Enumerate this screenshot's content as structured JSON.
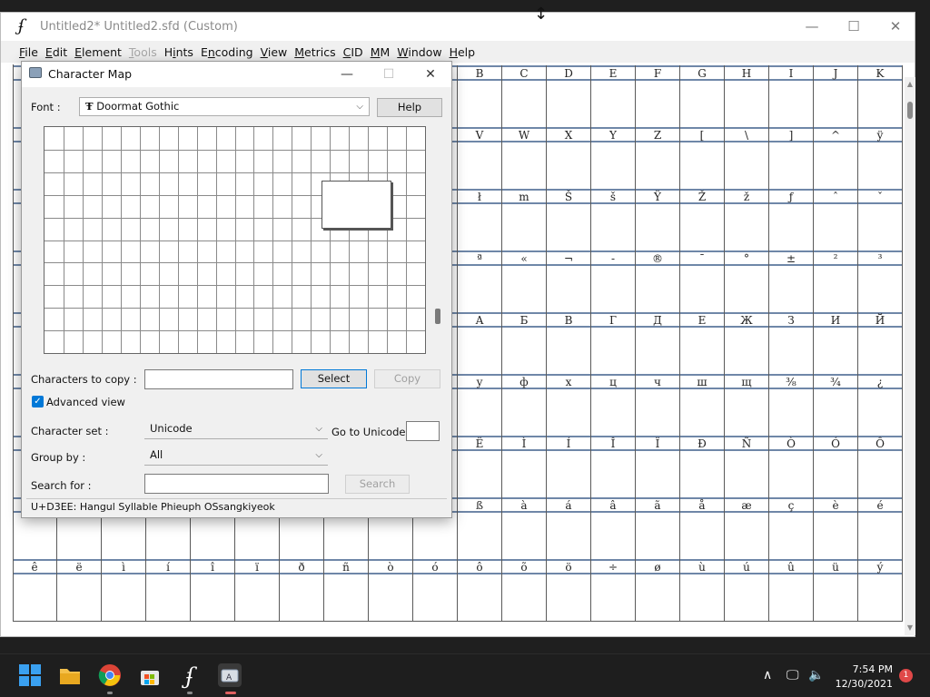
{
  "fontforge": {
    "logo": "ʄ",
    "title": "Untitled2*  Untitled2.sfd (Custom)",
    "menu": [
      {
        "label": "File",
        "u": "F",
        "rest": "ile",
        "disabled": false
      },
      {
        "label": "Edit",
        "u": "E",
        "rest": "dit",
        "disabled": false
      },
      {
        "label": "Element",
        "u": "E",
        "rest": "lement",
        "disabled": false
      },
      {
        "label": "Tools",
        "u": "T",
        "rest": "ools",
        "disabled": true
      },
      {
        "label": "Hints",
        "u": "i",
        "rest": "nts",
        "pre": "H",
        "disabled": false
      },
      {
        "label": "Encoding",
        "u": "n",
        "rest": "coding",
        "pre": "E",
        "disabled": false
      },
      {
        "label": "View",
        "u": "V",
        "rest": "iew",
        "disabled": false
      },
      {
        "label": "Metrics",
        "u": "M",
        "rest": "etrics",
        "disabled": false
      },
      {
        "label": "CID",
        "u": "C",
        "rest": "ID",
        "disabled": false
      },
      {
        "label": "MM",
        "u": "M",
        "rest": "M",
        "disabled": false
      },
      {
        "label": "Window",
        "u": "W",
        "rest": "indow",
        "disabled": false
      },
      {
        "label": "Help",
        "u": "H",
        "rest": "elp",
        "disabled": false
      }
    ],
    "glyph_rows": [
      [
        "",
        "",
        "",
        "",
        "",
        "",
        "",
        "",
        "",
        "",
        "B",
        "C",
        "D",
        "E",
        "F",
        "G",
        "H",
        "I",
        "J",
        "K"
      ],
      [
        "",
        "",
        "",
        "",
        "",
        "",
        "",
        "",
        "",
        "",
        "V",
        "W",
        "X",
        "Y",
        "Z",
        "[",
        "\\",
        "]",
        "^",
        "ÿ"
      ],
      [
        "",
        "",
        "",
        "",
        "",
        "",
        "",
        "",
        "",
        "",
        "ł",
        "m",
        "Š",
        "š",
        "Ÿ",
        "Ž",
        "ž",
        "ƒ",
        "ˆ",
        "ˇ"
      ],
      [
        "",
        "",
        "",
        "",
        "",
        "",
        "",
        "",
        "",
        "",
        "ª",
        "«",
        "¬",
        "-",
        "®",
        "¯",
        "°",
        "±",
        "²",
        "³"
      ],
      [
        "",
        "",
        "",
        "",
        "",
        "",
        "",
        "",
        "",
        "",
        "А",
        "Б",
        "В",
        "Г",
        "Д",
        "Е",
        "Ж",
        "З",
        "И",
        "Й"
      ],
      [
        "",
        "",
        "",
        "",
        "",
        "",
        "",
        "",
        "",
        "",
        "у",
        "ф",
        "х",
        "ц",
        "ч",
        "ш",
        "щ",
        "⅜",
        "¾",
        "¿"
      ],
      [
        "",
        "",
        "",
        "",
        "",
        "",
        "",
        "",
        "",
        "",
        "Ë",
        "Ì",
        "Í",
        "Î",
        "Ï",
        "Ð",
        "Ñ",
        "Ò",
        "Ó",
        "Ô"
      ],
      [
        "",
        "",
        "",
        "",
        "",
        "",
        "",
        "",
        "",
        "",
        "ß",
        "à",
        "á",
        "â",
        "ã",
        "å",
        "æ",
        "ç",
        "è",
        "é"
      ],
      [
        "ê",
        "ë",
        "ì",
        "í",
        "î",
        "ï",
        "ð",
        "ñ",
        "ò",
        "ó",
        "ô",
        "õ",
        "ö",
        "÷",
        "ø",
        "ù",
        "ú",
        "û",
        "ü",
        "ý"
      ]
    ]
  },
  "charmap": {
    "title": "Character Map",
    "font_label": "Font :",
    "font_value": "Doormat Gothic",
    "font_icon": "truetype-icon",
    "help_button": "Help",
    "chars_to_copy_label": "Characters to copy :",
    "chars_to_copy_value": "",
    "select_button": "Select",
    "copy_button": "Copy",
    "advanced_view_label": "Advanced view",
    "advanced_view_checked": true,
    "charset_label": "Character set :",
    "charset_value": "Unicode",
    "goto_unicode_label": "Go to Unicode :",
    "goto_unicode_value": "",
    "groupby_label": "Group by :",
    "groupby_value": "All",
    "search_label": "Search for :",
    "search_value": "",
    "search_button": "Search",
    "status": "U+D3EE: Hangul Syllable Phieuph OSsangkiyeok"
  },
  "taskbar": {
    "time": "7:54 PM",
    "date": "12/30/2021",
    "notifications": "1",
    "apps": [
      "start-icon",
      "file-explorer-icon",
      "chrome-icon",
      "store-icon",
      "fontforge-icon",
      "charmap-icon"
    ]
  }
}
